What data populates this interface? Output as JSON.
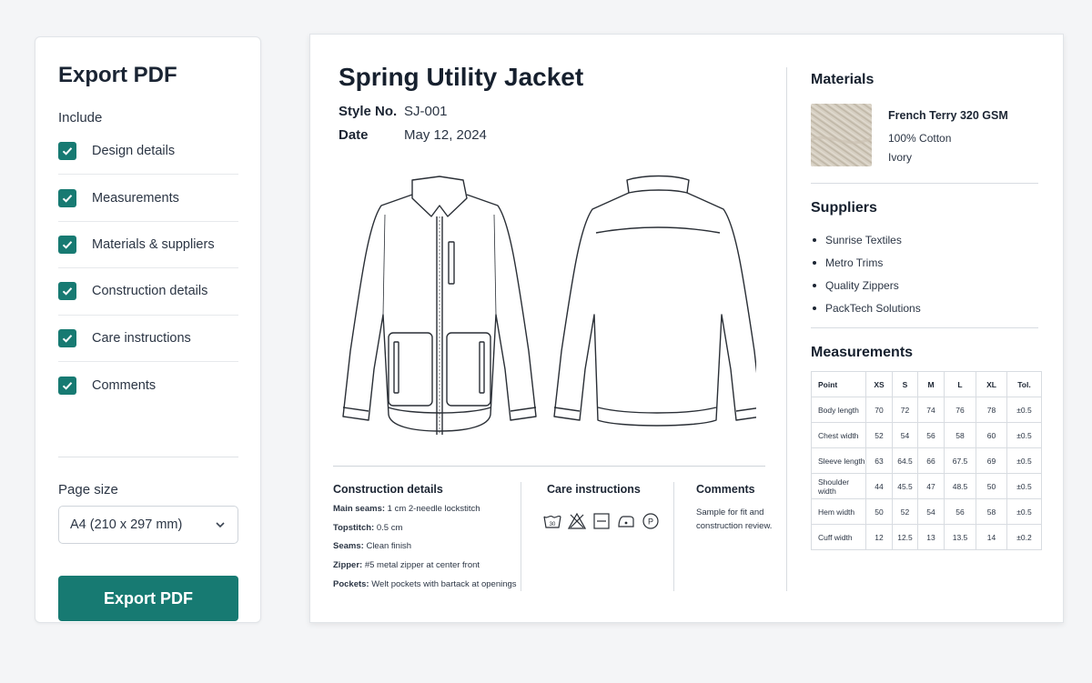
{
  "export_panel": {
    "title": "Export PDF",
    "include_label": "Include",
    "options": [
      {
        "label": "Design details",
        "checked": true
      },
      {
        "label": "Measurements",
        "checked": true
      },
      {
        "label": "Materials & suppliers",
        "checked": true
      },
      {
        "label": "Construction details",
        "checked": true
      },
      {
        "label": "Care instructions",
        "checked": true
      },
      {
        "label": "Comments",
        "checked": true
      }
    ],
    "page_size_label": "Page size",
    "page_size_value": "A4 (210 x 297 mm)",
    "export_button": "Export PDF",
    "accent_color": "#177a72"
  },
  "document": {
    "title": "Spring Utility Jacket",
    "style_no_label": "Style No.",
    "style_no": "SJ-001",
    "date_label": "Date",
    "date": "May 12, 2024",
    "construction": {
      "heading": "Construction details",
      "items": [
        {
          "key": "Main seams:",
          "value": "1 cm 2-needle lockstitch"
        },
        {
          "key": "Topstitch:",
          "value": "0.5 cm"
        },
        {
          "key": "Seams:",
          "value": "Clean finish"
        },
        {
          "key": "Zipper:",
          "value": "#5 metal zipper at center front"
        },
        {
          "key": "Pockets:",
          "value": "Welt pockets with bartack at openings"
        }
      ]
    },
    "care": {
      "heading": "Care instructions",
      "icons": [
        "wash-30-icon",
        "do-not-bleach-icon",
        "dry-flat-icon",
        "iron-low-icon",
        "dry-clean-p-icon"
      ],
      "wash_temp": "30",
      "dry_clean_letter": "P"
    },
    "comments": {
      "heading": "Comments",
      "text": "Sample for fit and construction review."
    },
    "materials": {
      "heading": "Materials",
      "name": "French Terry 320 GSM",
      "composition": "100% Cotton",
      "color": "Ivory"
    },
    "suppliers": {
      "heading": "Suppliers",
      "items": [
        "Sunrise Textiles",
        "Metro Trims",
        "Quality Zippers",
        "PackTech Solutions"
      ]
    },
    "measurements": {
      "heading": "Measurements",
      "columns": [
        "Point",
        "XS",
        "S",
        "M",
        "L",
        "XL",
        "Tol."
      ],
      "rows": [
        [
          "Body length",
          "70",
          "72",
          "74",
          "76",
          "78",
          "±0.5"
        ],
        [
          "Chest width",
          "52",
          "54",
          "56",
          "58",
          "60",
          "±0.5"
        ],
        [
          "Sleeve length",
          "63",
          "64.5",
          "66",
          "67.5",
          "69",
          "±0.5"
        ],
        [
          "Shoulder width",
          "44",
          "45.5",
          "47",
          "48.5",
          "50",
          "±0.5"
        ],
        [
          "Hem width",
          "50",
          "52",
          "54",
          "56",
          "58",
          "±0.5"
        ],
        [
          "Cuff width",
          "12",
          "12.5",
          "13",
          "13.5",
          "14",
          "±0.2"
        ]
      ]
    }
  }
}
